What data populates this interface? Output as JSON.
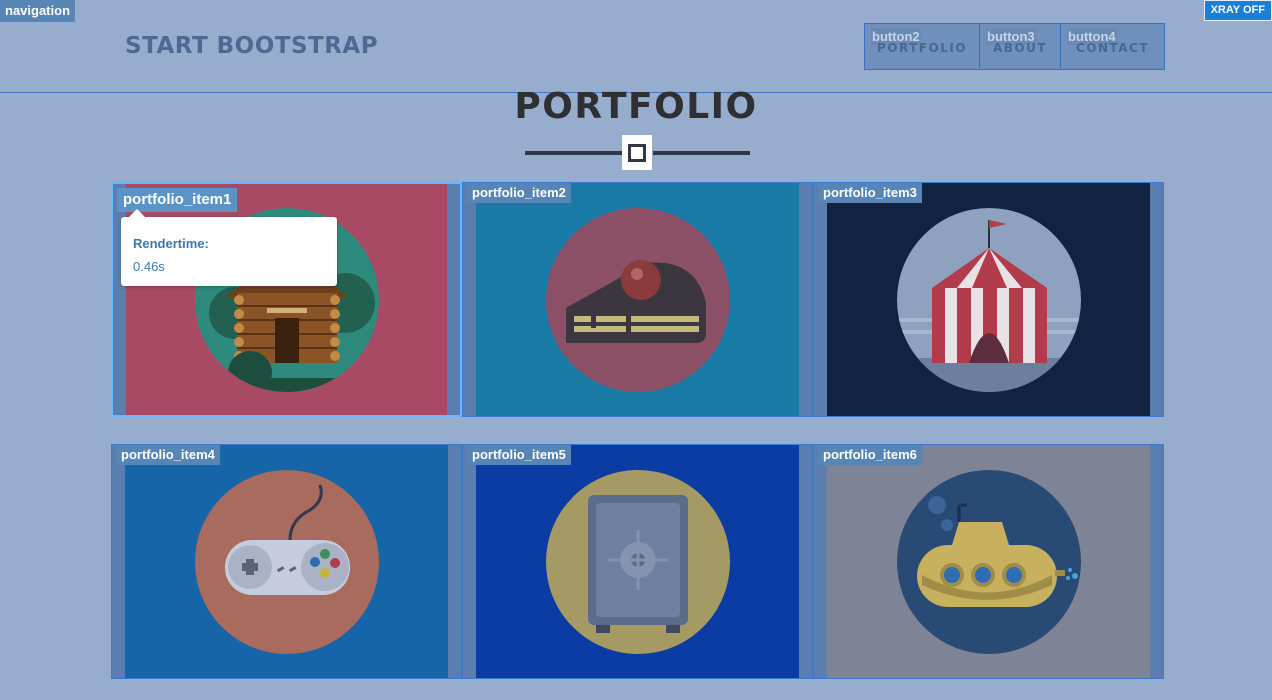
{
  "xray": {
    "navigation_label": "navigation",
    "toggle_label": "XRAY OFF"
  },
  "header": {
    "brand": "START BOOTSTRAP",
    "buttons": [
      {
        "tag": "button2",
        "label": "PORTFOLIO"
      },
      {
        "tag": "button3",
        "label": "ABOUT"
      },
      {
        "tag": "button4",
        "label": "CONTACT"
      }
    ]
  },
  "section": {
    "title": "PORTFOLIO",
    "divider_icon": "star-icon"
  },
  "portfolio": {
    "items": [
      {
        "tag": "portfolio_item1",
        "image": "cabin-icon",
        "bg": "#a84a64",
        "circle": "#2f8a7e"
      },
      {
        "tag": "portfolio_item2",
        "image": "cake-icon",
        "bg": "#1a7aa6",
        "circle": "#8b5066"
      },
      {
        "tag": "portfolio_item3",
        "image": "circus-tent-icon",
        "bg": "#112341",
        "circle": "#8ea1bf"
      },
      {
        "tag": "portfolio_item4",
        "image": "game-controller-icon",
        "bg": "#1665a8",
        "circle": "#a86b5d"
      },
      {
        "tag": "portfolio_item5",
        "image": "safe-icon",
        "bg": "#0b3ca3",
        "circle": "#a59a63"
      },
      {
        "tag": "portfolio_item6",
        "image": "submarine-icon",
        "bg": "#7f8396",
        "circle": "#284a75"
      }
    ]
  },
  "tooltip": {
    "title": "Rendertime:",
    "value": "0.46s"
  }
}
